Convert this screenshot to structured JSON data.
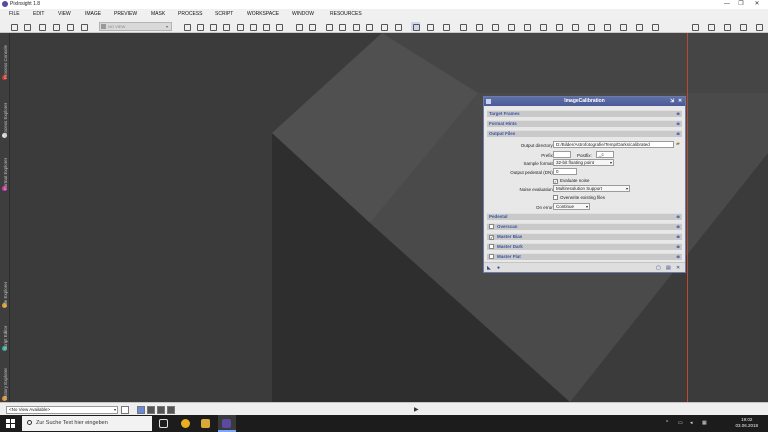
{
  "window": {
    "title": "PixInsight 1.8",
    "controls": [
      "—",
      "❐",
      "✕"
    ]
  },
  "menu": [
    "FILE",
    "EDIT",
    "VIEW",
    "IMAGE",
    "PREVIEW",
    "MASK",
    "PROCESS",
    "SCRIPT",
    "WORKSPACE",
    "WINDOW",
    "RESOURCES"
  ],
  "toolbar": {
    "view_selector": "NO VIEW"
  },
  "sidebar": {
    "tabs": [
      "Process Console",
      "Process Explorer",
      "Format Explorer",
      "File Explorer",
      "Script Editor",
      "History Explorer"
    ]
  },
  "panel": {
    "title": "ImageCalibration",
    "sections": {
      "target_frames": "Target Frames",
      "format_hints": "Format Hints",
      "output_files": "Output Files",
      "pedestal": "Pedestal",
      "overscan": "Overscan",
      "master_bias": "Master Bias",
      "master_dark": "Master Dark",
      "master_flat": "Master Flat"
    },
    "output": {
      "dir_label": "Output directory:",
      "dir_value": "D:/Bilder/Astrofotografie/Temp/Darks/calibrated",
      "prefix_label": "Prefix:",
      "prefix_value": "",
      "postfix_label": "Postfix:",
      "postfix_value": "_c",
      "sample_label": "Sample format:",
      "sample_value": "32-bit floating point",
      "pedestal_label": "Output pedestal (DN):",
      "pedestal_value": "0",
      "evaluate_noise": "Evaluate noise",
      "noise_label": "Noise evaluation:",
      "noise_value": "Multiresolution Support",
      "overwrite": "Overwrite existing files",
      "onerror_label": "On error:",
      "onerror_value": "Continue"
    },
    "checks": {
      "evaluate_noise": true,
      "overwrite": false,
      "overscan": false,
      "master_bias": true,
      "master_dark": false,
      "master_flat": false
    }
  },
  "status": {
    "view_list": "<No View Available>"
  },
  "taskbar": {
    "search_placeholder": "Zur Suche Text hier eingeben",
    "time": "19:02",
    "date": "03.06.2018"
  },
  "colors": {
    "panel_title": "#4a5a96",
    "section_text": "#3a55a0",
    "accent_line": "#b84a2e"
  }
}
